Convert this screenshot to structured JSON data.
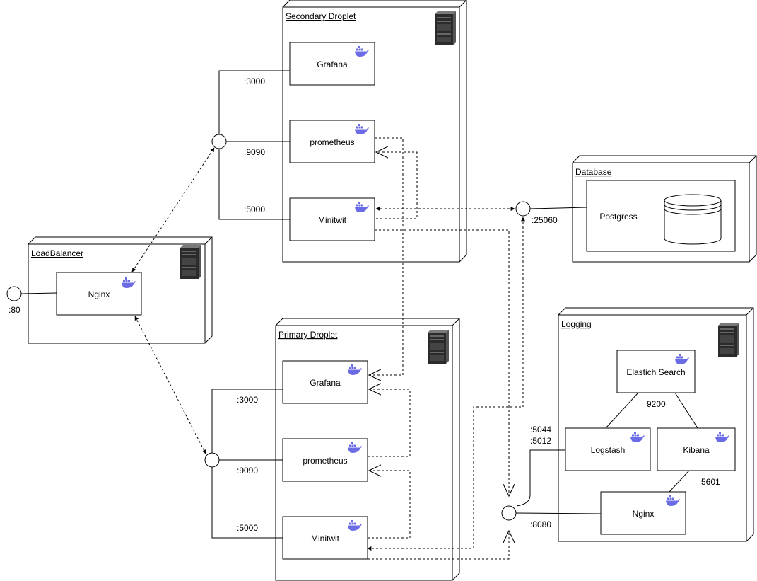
{
  "colors": {
    "docker": "#6b6be6",
    "server_dark": "#2b2b2b",
    "server_light": "#7a7a7a",
    "stroke": "#000000"
  },
  "nodes": {
    "secondary": {
      "title": "Secondary Droplet",
      "icon": "server-rack-icon"
    },
    "primary": {
      "title": "Primary Droplet",
      "icon": "server-rack-icon"
    },
    "loadbalancer": {
      "title": "LoadBalancer",
      "icon": "server-rack-icon"
    },
    "database": {
      "title": "Database"
    },
    "logging": {
      "title": "Logging",
      "icon": "server-rack-icon"
    }
  },
  "components": {
    "sec_grafana": "Grafana",
    "sec_prometheus": "prometheus",
    "sec_minitwit": "Minitwit",
    "pri_grafana": "Grafana",
    "pri_prometheus": "prometheus",
    "pri_minitwit": "Minitwit",
    "lb_nginx": "Nginx",
    "db_postgress": "Postgress",
    "log_elastic": "Elastich Search",
    "log_logstash": "Logstash",
    "log_kibana": "Kibana",
    "log_nginx": "Nginx"
  },
  "ports": {
    "sec_3000": ":3000",
    "sec_9090": ":9090",
    "sec_5000": ":5000",
    "pri_3000": ":3000",
    "pri_9090": ":9090",
    "pri_5000": ":5000",
    "lb_80": ":80",
    "db_25060": ":25060",
    "log_5044": ":5044",
    "log_5012": ":5012",
    "log_8080": ":8080",
    "es_9200": "9200",
    "kibana_5601": "5601"
  }
}
